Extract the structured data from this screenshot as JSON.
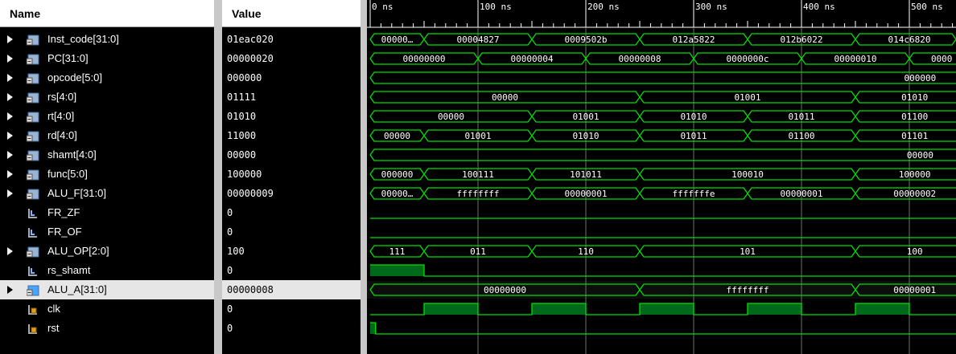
{
  "headers": {
    "name": "Name",
    "value": "Value"
  },
  "timeline": {
    "labels": [
      "0 ns",
      "100 ns",
      "200 ns",
      "300 ns",
      "400 ns",
      "500 ns"
    ]
  },
  "signals": [
    {
      "name": "Inst_code[31:0]",
      "value": "01eac020",
      "kind": "bus",
      "expandable": true,
      "icon": "bus-signal-icon",
      "segments": [
        {
          "t0": 0,
          "t1": 50,
          "label": "00000…"
        },
        {
          "t0": 50,
          "t1": 150,
          "label": "00004827"
        },
        {
          "t0": 150,
          "t1": 250,
          "label": "0009502b"
        },
        {
          "t0": 250,
          "t1": 350,
          "label": "012a5822"
        },
        {
          "t0": 350,
          "t1": 450,
          "label": "012b6022"
        },
        {
          "t0": 450,
          "t1": 550,
          "label": "014c6820"
        }
      ]
    },
    {
      "name": "PC[31:0]",
      "value": "00000020",
      "kind": "bus",
      "expandable": true,
      "icon": "bus-signal-icon",
      "segments": [
        {
          "t0": 0,
          "t1": 100,
          "label": "00000000"
        },
        {
          "t0": 100,
          "t1": 200,
          "label": "00000004"
        },
        {
          "t0": 200,
          "t1": 300,
          "label": "00000008"
        },
        {
          "t0": 300,
          "t1": 400,
          "label": "0000000c"
        },
        {
          "t0": 400,
          "t1": 500,
          "label": "00000010"
        },
        {
          "t0": 500,
          "t1": 560,
          "label": "0000"
        }
      ]
    },
    {
      "name": "opcode[5:0]",
      "value": "000000",
      "kind": "bus",
      "expandable": true,
      "icon": "bus-signal-icon",
      "segments": [
        {
          "t0": 0,
          "t1": 560,
          "label": "000000",
          "tlabel": 510
        }
      ]
    },
    {
      "name": "rs[4:0]",
      "value": "01111",
      "kind": "bus",
      "expandable": true,
      "icon": "bus-signal-icon",
      "segments": [
        {
          "t0": 0,
          "t1": 250,
          "label": "00000"
        },
        {
          "t0": 250,
          "t1": 450,
          "label": "01001"
        },
        {
          "t0": 450,
          "t1": 560,
          "label": "01010",
          "tlabel": 505
        }
      ]
    },
    {
      "name": "rt[4:0]",
      "value": "01010",
      "kind": "bus",
      "expandable": true,
      "icon": "bus-signal-icon",
      "segments": [
        {
          "t0": 0,
          "t1": 150,
          "label": "00000"
        },
        {
          "t0": 150,
          "t1": 250,
          "label": "01001"
        },
        {
          "t0": 250,
          "t1": 350,
          "label": "01010"
        },
        {
          "t0": 350,
          "t1": 450,
          "label": "01011"
        },
        {
          "t0": 450,
          "t1": 560,
          "label": "01100",
          "tlabel": 505
        }
      ]
    },
    {
      "name": "rd[4:0]",
      "value": "11000",
      "kind": "bus",
      "expandable": true,
      "icon": "bus-signal-icon",
      "segments": [
        {
          "t0": 0,
          "t1": 50,
          "label": "00000"
        },
        {
          "t0": 50,
          "t1": 150,
          "label": "01001"
        },
        {
          "t0": 150,
          "t1": 250,
          "label": "01010"
        },
        {
          "t0": 250,
          "t1": 350,
          "label": "01011"
        },
        {
          "t0": 350,
          "t1": 450,
          "label": "01100"
        },
        {
          "t0": 450,
          "t1": 560,
          "label": "01101",
          "tlabel": 505
        }
      ]
    },
    {
      "name": "shamt[4:0]",
      "value": "00000",
      "kind": "bus",
      "expandable": true,
      "icon": "bus-signal-icon",
      "segments": [
        {
          "t0": 0,
          "t1": 560,
          "label": "00000",
          "tlabel": 510
        }
      ]
    },
    {
      "name": "func[5:0]",
      "value": "100000",
      "kind": "bus",
      "expandable": true,
      "icon": "bus-signal-icon",
      "segments": [
        {
          "t0": 0,
          "t1": 50,
          "label": "000000"
        },
        {
          "t0": 50,
          "t1": 150,
          "label": "100111"
        },
        {
          "t0": 150,
          "t1": 250,
          "label": "101011"
        },
        {
          "t0": 250,
          "t1": 450,
          "label": "100010"
        },
        {
          "t0": 450,
          "t1": 560,
          "label": "100000",
          "tlabel": 505
        }
      ]
    },
    {
      "name": "ALU_F[31:0]",
      "value": "00000009",
      "kind": "bus",
      "expandable": true,
      "icon": "bus-signal-icon",
      "segments": [
        {
          "t0": 0,
          "t1": 50,
          "label": "00000…"
        },
        {
          "t0": 50,
          "t1": 150,
          "label": "ffffffff"
        },
        {
          "t0": 150,
          "t1": 250,
          "label": "00000001"
        },
        {
          "t0": 250,
          "t1": 350,
          "label": "fffffffe"
        },
        {
          "t0": 350,
          "t1": 450,
          "label": "00000001"
        },
        {
          "t0": 450,
          "t1": 560,
          "label": "00000002",
          "tlabel": 505
        }
      ]
    },
    {
      "name": "FR_ZF",
      "value": "0",
      "kind": "bit",
      "expandable": false,
      "icon": "bit-signal-icon",
      "levels": [
        {
          "t0": 0,
          "t1": 560,
          "v": 0
        }
      ]
    },
    {
      "name": "FR_OF",
      "value": "0",
      "kind": "bit",
      "expandable": false,
      "icon": "bit-signal-icon",
      "levels": [
        {
          "t0": 0,
          "t1": 560,
          "v": 0
        }
      ]
    },
    {
      "name": "ALU_OP[2:0]",
      "value": "100",
      "kind": "bus",
      "expandable": true,
      "icon": "bus-signal-icon",
      "segments": [
        {
          "t0": 0,
          "t1": 50,
          "label": "111"
        },
        {
          "t0": 50,
          "t1": 150,
          "label": "011"
        },
        {
          "t0": 150,
          "t1": 250,
          "label": "110"
        },
        {
          "t0": 250,
          "t1": 450,
          "label": "101"
        },
        {
          "t0": 450,
          "t1": 560,
          "label": "100",
          "tlabel": 505
        }
      ]
    },
    {
      "name": "rs_shamt",
      "value": "0",
      "kind": "bit",
      "expandable": false,
      "icon": "bit-signal-icon",
      "levels": [
        {
          "t0": 0,
          "t1": 50,
          "v": 1
        },
        {
          "t0": 50,
          "t1": 560,
          "v": 0
        }
      ]
    },
    {
      "name": "ALU_A[31:0]",
      "value": "00000008",
      "kind": "bus",
      "expandable": true,
      "selected": true,
      "icon": "bus-signal-selected-icon",
      "segments": [
        {
          "t0": 0,
          "t1": 250,
          "label": "00000000"
        },
        {
          "t0": 250,
          "t1": 450,
          "label": "ffffffff"
        },
        {
          "t0": 450,
          "t1": 560,
          "label": "00000001",
          "tlabel": 505
        }
      ]
    },
    {
      "name": "clk",
      "value": "0",
      "kind": "bit",
      "expandable": false,
      "icon": "clock-signal-icon",
      "levels": [
        {
          "t0": 0,
          "t1": 50,
          "v": 0
        },
        {
          "t0": 50,
          "t1": 100,
          "v": 1
        },
        {
          "t0": 100,
          "t1": 150,
          "v": 0
        },
        {
          "t0": 150,
          "t1": 200,
          "v": 1
        },
        {
          "t0": 200,
          "t1": 250,
          "v": 0
        },
        {
          "t0": 250,
          "t1": 300,
          "v": 1
        },
        {
          "t0": 300,
          "t1": 350,
          "v": 0
        },
        {
          "t0": 350,
          "t1": 400,
          "v": 1
        },
        {
          "t0": 400,
          "t1": 450,
          "v": 0
        },
        {
          "t0": 450,
          "t1": 500,
          "v": 1
        },
        {
          "t0": 500,
          "t1": 560,
          "v": 0
        }
      ]
    },
    {
      "name": "rst",
      "value": "0",
      "kind": "bit",
      "expandable": false,
      "icon": "clock-signal-icon",
      "levels": [
        {
          "t0": 0,
          "t1": 5,
          "v": 1
        },
        {
          "t0": 5,
          "t1": 560,
          "v": 0
        }
      ]
    }
  ],
  "colors": {
    "wave": "#00e000",
    "high_fill": "#006a1a",
    "text": "#ffffff",
    "grid": "#707070",
    "selection": "#e6e6e6"
  }
}
